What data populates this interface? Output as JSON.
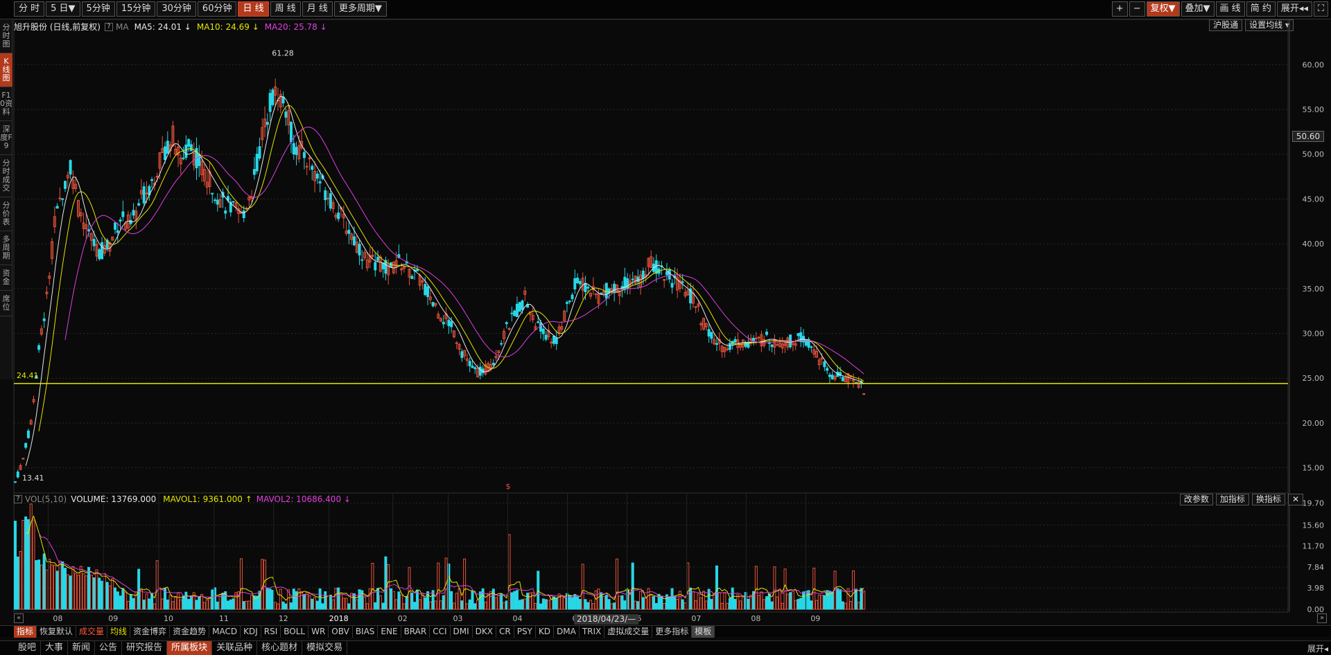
{
  "period_tabs": [
    "分 时",
    "5 日▼",
    "5分钟",
    "15分钟",
    "30分钟",
    "60分钟",
    "日 线",
    "周 线",
    "月 线",
    "更多周期▼"
  ],
  "period_active": 6,
  "right_tools": [
    "+",
    "−",
    "复权▼",
    "叠加▼",
    "画 线",
    "简 约",
    "展开◂◂",
    "⛶"
  ],
  "right_tools_active": 2,
  "sidebar_tabs": [
    "分时图",
    "K线图",
    "F10资料",
    "深度F9",
    "分时成交",
    "分价表",
    "多周期",
    "资金",
    "席位"
  ],
  "sidebar_active": 1,
  "legend": {
    "name": "旭升股份 (日线,前复权)",
    "help": "?",
    "ma_label": "MA",
    "ma5": "MA5: 24.01 ↓",
    "ma10": "MA10: 24.69 ↓",
    "ma20": "MA20: 25.78 ↓"
  },
  "chart_btns": [
    "沪股通",
    "设置均线 ▾"
  ],
  "price_tag": "50.60",
  "markers": {
    "high": "61.28",
    "low": "13.41",
    "line": "24.41",
    "dollar": "$"
  },
  "vol_legend": {
    "help": "?",
    "label": "VOL(5,10)",
    "volume": "VOLUME: 13769.000",
    "mavol1": "MAVOL1: 9361.000 ↑",
    "mavol2": "MAVOL2: 10686.400 ↓"
  },
  "vol_btns": [
    "改参数",
    "加指标",
    "换指标",
    "✕"
  ],
  "date_label": "2018/04/23/—",
  "indicator_tabs": [
    {
      "label": "指标",
      "style": "active"
    },
    {
      "label": "恢复默认",
      "style": ""
    },
    {
      "label": "成交量",
      "style": "red"
    },
    {
      "label": "均线",
      "style": "yellow"
    },
    {
      "label": "资金博弈",
      "style": ""
    },
    {
      "label": "资金趋势",
      "style": ""
    },
    {
      "label": "MACD",
      "style": ""
    },
    {
      "label": "KDJ",
      "style": ""
    },
    {
      "label": "RSI",
      "style": ""
    },
    {
      "label": "BOLL",
      "style": ""
    },
    {
      "label": "WR",
      "style": ""
    },
    {
      "label": "OBV",
      "style": ""
    },
    {
      "label": "BIAS",
      "style": ""
    },
    {
      "label": "ENE",
      "style": ""
    },
    {
      "label": "BRAR",
      "style": ""
    },
    {
      "label": "CCI",
      "style": ""
    },
    {
      "label": "DMI",
      "style": ""
    },
    {
      "label": "DKX",
      "style": ""
    },
    {
      "label": "CR",
      "style": ""
    },
    {
      "label": "PSY",
      "style": ""
    },
    {
      "label": "KD",
      "style": ""
    },
    {
      "label": "DMA",
      "style": ""
    },
    {
      "label": "TRIX",
      "style": ""
    },
    {
      "label": "虚拟成交量",
      "style": ""
    },
    {
      "label": "更多指标",
      "style": ""
    },
    {
      "label": "模板",
      "style": "gray"
    }
  ],
  "nav_tabs": [
    "股吧",
    "大事",
    "新闻",
    "公告",
    "研究报告",
    "所属板块",
    "关联品种",
    "核心题材",
    "模拟交易"
  ],
  "nav_active": 5,
  "expand_label": "展开◂",
  "scroll_left": "«",
  "scroll_right": "»",
  "colors": {
    "up": "#e8533a",
    "down": "#28d7e6",
    "ma5": "#e8e8e8",
    "ma10": "#e6e600",
    "ma20": "#e040e0",
    "hline": "#e6e600"
  },
  "chart_data": {
    "type": "candlestick",
    "title": "旭升股份 (日线,前复权)",
    "y_ticks": [
      "60.00",
      "55.00",
      "50.00",
      "45.00",
      "40.00",
      "35.00",
      "30.00",
      "25.00",
      "20.00",
      "15.00"
    ],
    "ylim": [
      12.5,
      63.5
    ],
    "x_labels": [
      "08",
      "09",
      "10",
      "11",
      "12",
      "2018",
      "02",
      "03",
      "04",
      "05",
      "06",
      "07",
      "08",
      "09"
    ],
    "high": 61.28,
    "low": 13.41,
    "hline": 24.41,
    "close_path_keypoints": [
      [
        0,
        13.41
      ],
      [
        3,
        16
      ],
      [
        6,
        20
      ],
      [
        9,
        28
      ],
      [
        12,
        34
      ],
      [
        15,
        42
      ],
      [
        18,
        46
      ],
      [
        21,
        49
      ],
      [
        24,
        44
      ],
      [
        28,
        41
      ],
      [
        32,
        39
      ],
      [
        36,
        40
      ],
      [
        40,
        43
      ],
      [
        44,
        42
      ],
      [
        48,
        45
      ],
      [
        52,
        47
      ],
      [
        56,
        50
      ],
      [
        60,
        52
      ],
      [
        63,
        49
      ],
      [
        66,
        51
      ],
      [
        70,
        49
      ],
      [
        74,
        47
      ],
      [
        78,
        45
      ],
      [
        82,
        44
      ],
      [
        86,
        43
      ],
      [
        90,
        46
      ],
      [
        94,
        52
      ],
      [
        97,
        56
      ],
      [
        100,
        57
      ],
      [
        103,
        55
      ],
      [
        106,
        51
      ],
      [
        110,
        50
      ],
      [
        114,
        48
      ],
      [
        118,
        46
      ],
      [
        122,
        44
      ],
      [
        126,
        42
      ],
      [
        130,
        40
      ],
      [
        134,
        38
      ],
      [
        138,
        38
      ],
      [
        142,
        37
      ],
      [
        146,
        38
      ],
      [
        150,
        37
      ],
      [
        154,
        36
      ],
      [
        158,
        34
      ],
      [
        162,
        32
      ],
      [
        166,
        31
      ],
      [
        170,
        28
      ],
      [
        174,
        26
      ],
      [
        178,
        25.5
      ],
      [
        182,
        27
      ],
      [
        186,
        30
      ],
      [
        190,
        32
      ],
      [
        194,
        34
      ],
      [
        198,
        31
      ],
      [
        202,
        30
      ],
      [
        206,
        29
      ],
      [
        210,
        33
      ],
      [
        214,
        36
      ],
      [
        218,
        35
      ],
      [
        222,
        34
      ],
      [
        226,
        35
      ],
      [
        230,
        35
      ],
      [
        234,
        36
      ],
      [
        238,
        36
      ],
      [
        242,
        38
      ],
      [
        246,
        37
      ],
      [
        250,
        36
      ],
      [
        254,
        35
      ],
      [
        258,
        34
      ],
      [
        262,
        31
      ],
      [
        266,
        29
      ],
      [
        270,
        28.5
      ],
      [
        274,
        29
      ],
      [
        278,
        29
      ],
      [
        282,
        29
      ],
      [
        286,
        29.5
      ],
      [
        290,
        29
      ],
      [
        294,
        29
      ],
      [
        298,
        29.5
      ],
      [
        302,
        29
      ],
      [
        306,
        27
      ],
      [
        310,
        25.5
      ],
      [
        314,
        25.2
      ],
      [
        318,
        24.8
      ],
      [
        322,
        24.5
      ],
      [
        323,
        23.2
      ]
    ],
    "volume_y_ticks": [
      "19.70",
      "15.60",
      "11.70",
      "7.84",
      "3.98",
      "0.00"
    ],
    "volume_ylim": [
      0,
      20
    ]
  }
}
